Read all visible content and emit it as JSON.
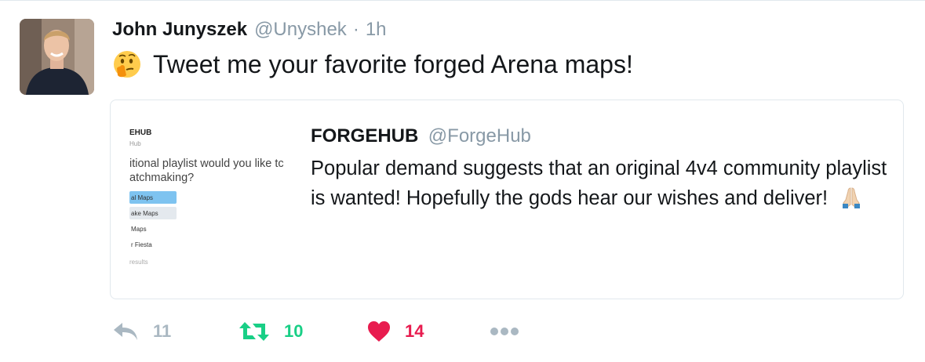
{
  "tweet": {
    "author_name": "John Junyszek",
    "author_handle": "@Unyshek",
    "separator": "·",
    "time": "1h",
    "text": "Tweet me your favorite forged Arena maps!",
    "emoji": "thinking-face-icon"
  },
  "quoted": {
    "name": "FORGEHUB",
    "handle": "@ForgeHub",
    "text": "Popular demand suggests that an original 4v4 community playlist is wanted!  Hopefully the gods hear our wishes and deliver!",
    "emoji": "folded-hands-icon",
    "media": {
      "title": "EHUB",
      "subtitle": "Hub",
      "question_line1": "itional playlist would you like tc",
      "question_line2": "atchmaking?",
      "options": [
        "al Maps",
        "ake Maps",
        "Maps",
        "r Fiesta"
      ],
      "results": "results"
    }
  },
  "actions": {
    "reply_count": "11",
    "retweet_count": "10",
    "like_count": "14",
    "colors": {
      "reply": "#aab8c2",
      "retweet": "#19cf86",
      "like": "#e81c4f",
      "more": "#aab8c2"
    }
  }
}
